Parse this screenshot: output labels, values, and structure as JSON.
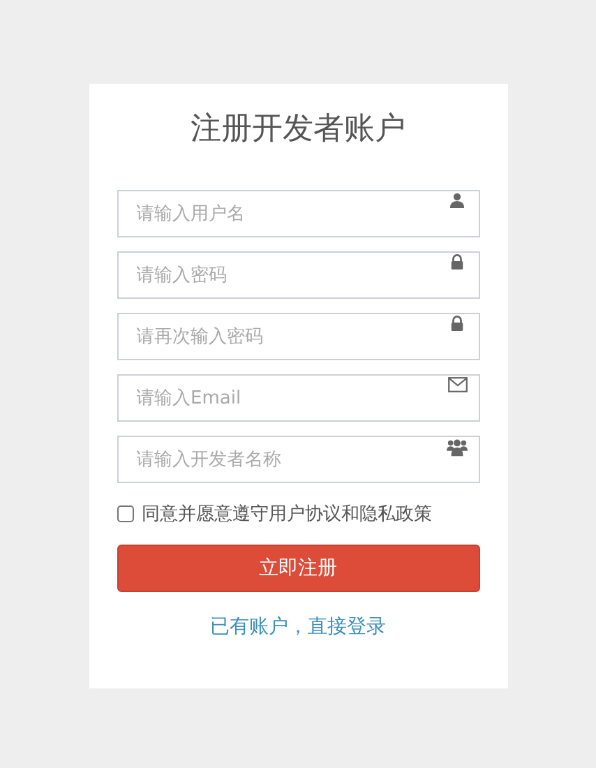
{
  "title": "注册开发者账户",
  "fields": [
    {
      "placeholder": "请输入用户名",
      "kind": "user"
    },
    {
      "placeholder": "请输入密码",
      "kind": "lock"
    },
    {
      "placeholder": "请再次输入密码",
      "kind": "lock"
    },
    {
      "placeholder": "请输入Email",
      "kind": "mail"
    },
    {
      "placeholder": "请输入开发者名称",
      "kind": "group"
    }
  ],
  "agreement": {
    "label": "同意并愿意遵守用户协议和隐私政策",
    "checked": false
  },
  "submit_button": "立即注册",
  "login_link": "已有账户，直接登录"
}
